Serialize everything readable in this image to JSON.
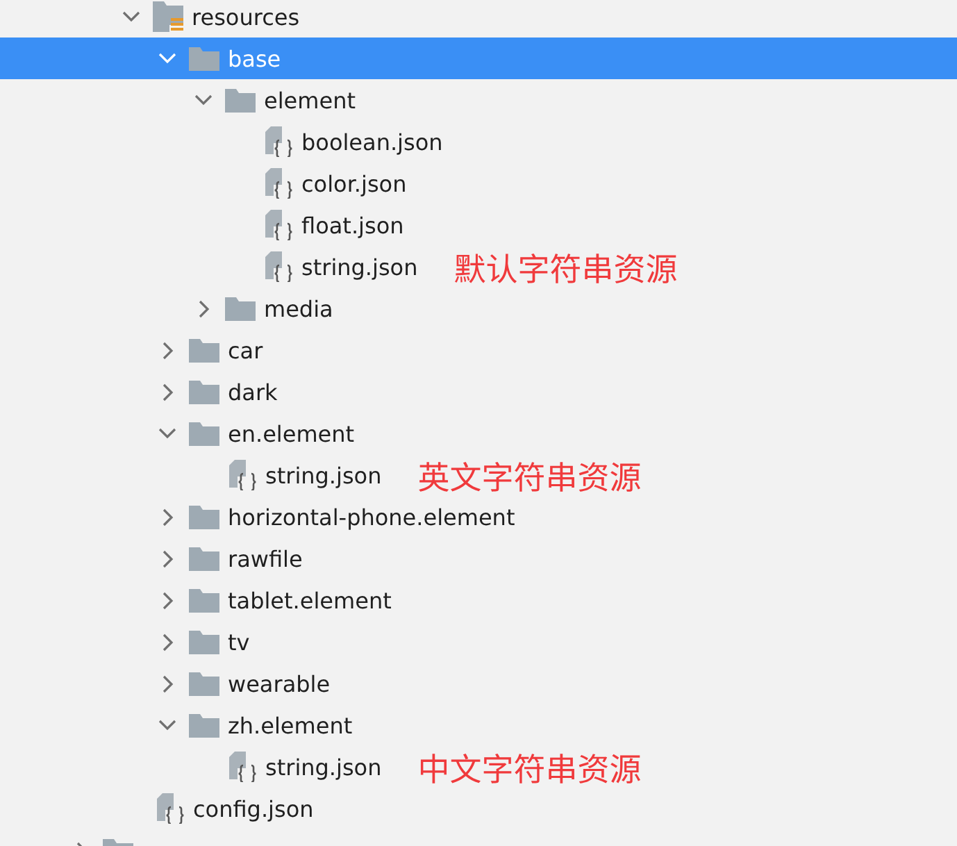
{
  "tree": [
    {
      "kind": "resources-folder",
      "label": "resources",
      "expanded": true,
      "selected": false,
      "children": [
        {
          "kind": "folder",
          "label": "base",
          "expanded": true,
          "selected": true,
          "children": [
            {
              "kind": "folder",
              "label": "element",
              "expanded": true,
              "selected": false,
              "children": [
                {
                  "kind": "json-file",
                  "label": "boolean.json",
                  "selected": false
                },
                {
                  "kind": "json-file",
                  "label": "color.json",
                  "selected": false
                },
                {
                  "kind": "json-file",
                  "label": "float.json",
                  "selected": false
                },
                {
                  "kind": "json-file",
                  "label": "string.json",
                  "selected": false,
                  "note": "默认字符串资源"
                }
              ]
            },
            {
              "kind": "folder",
              "label": "media",
              "expanded": false,
              "selected": false
            }
          ]
        },
        {
          "kind": "folder",
          "label": "car",
          "expanded": false,
          "selected": false
        },
        {
          "kind": "folder",
          "label": "dark",
          "expanded": false,
          "selected": false
        },
        {
          "kind": "folder",
          "label": "en.element",
          "expanded": true,
          "selected": false,
          "children": [
            {
              "kind": "json-file",
              "label": "string.json",
              "selected": false,
              "note": "英文字符串资源"
            }
          ]
        },
        {
          "kind": "folder",
          "label": "horizontal-phone.element",
          "expanded": false,
          "selected": false
        },
        {
          "kind": "folder",
          "label": "rawfile",
          "expanded": false,
          "selected": false
        },
        {
          "kind": "folder",
          "label": "tablet.element",
          "expanded": false,
          "selected": false
        },
        {
          "kind": "folder",
          "label": "tv",
          "expanded": false,
          "selected": false
        },
        {
          "kind": "folder",
          "label": "wearable",
          "expanded": false,
          "selected": false
        },
        {
          "kind": "folder",
          "label": "zh.element",
          "expanded": true,
          "selected": false,
          "children": [
            {
              "kind": "json-file",
              "label": "string.json",
              "selected": false,
              "note": "中文字符串资源"
            }
          ]
        }
      ]
    },
    {
      "kind": "json-file",
      "label": "config.json",
      "selected": false
    }
  ],
  "clipped_row": {
    "kind": "folder",
    "expanded": false,
    "selected": false
  }
}
